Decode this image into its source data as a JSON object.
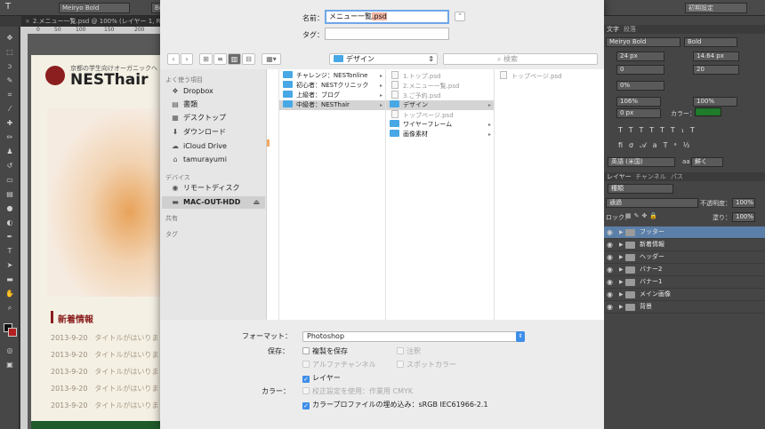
{
  "ps": {
    "tool_icon": "T",
    "font_name": "Meiryo Bold",
    "font_style_short": "Bo",
    "tab_title": "2.メニュー一覧.psd @ 100% (レイヤー 1, RGB",
    "ruler_marks": [
      "0",
      "50",
      "100",
      "150",
      "200"
    ],
    "preset": "初期設定"
  },
  "canvas": {
    "tagline": "京都の学生向けオーガニックヘ",
    "brand": "NESThair",
    "news_title": "新着情報",
    "news": [
      {
        "date": "2013-9-20",
        "title": "タイトルがはいりま"
      },
      {
        "date": "2013-9-20",
        "title": "タイトルがはいりま"
      },
      {
        "date": "2013-9-20",
        "title": "タイトルがはいりま"
      },
      {
        "date": "2013-9-20",
        "title": "タイトルがはいりま"
      },
      {
        "date": "2013-9-20",
        "title": "タイトルがはいりま"
      }
    ]
  },
  "dialog": {
    "name_label": "名前：",
    "name_value_base": "メニュー一覧",
    "name_value_ext": ".psd",
    "tags_label": "タグ：",
    "tags_value": "",
    "location": "デザイン",
    "search_placeholder": "検索",
    "sidebar": {
      "favorites_head": "よく使う項目",
      "favorites": [
        {
          "icon": "dropbox-icon",
          "label": "Dropbox"
        },
        {
          "icon": "documents-icon",
          "label": "書類"
        },
        {
          "icon": "desktop-icon",
          "label": "デスクトップ"
        },
        {
          "icon": "downloads-icon",
          "label": "ダウンロード"
        },
        {
          "icon": "icloud-icon",
          "label": "iCloud Drive"
        },
        {
          "icon": "home-icon",
          "label": "tamurayumi"
        }
      ],
      "devices_head": "デバイス",
      "devices": [
        {
          "icon": "remote-disc-icon",
          "label": "リモートディスク"
        },
        {
          "icon": "hdd-icon",
          "label": "MAC-OUT-HDD"
        }
      ],
      "shared_head": "共有",
      "tags_head": "タグ"
    },
    "columns": {
      "col1": [
        {
          "label": "チャレンジ：NESTonline"
        },
        {
          "label": "初心者：NESTクリニック"
        },
        {
          "label": "上級者：ブログ"
        },
        {
          "label": "中級者：NESThair"
        }
      ],
      "col2": [
        {
          "label": "1.トップ.psd"
        },
        {
          "label": "2.メニュー一覧.psd"
        },
        {
          "label": "3.ご予約.psd"
        },
        {
          "label": "デザイン"
        },
        {
          "label": "トップページ.psd"
        },
        {
          "label": "ワイヤーフレーム"
        },
        {
          "label": "画像素材"
        }
      ],
      "col3": [
        {
          "label": "トップページ.psd"
        }
      ]
    },
    "format_label": "フォーマット：",
    "format_value": "Photoshop",
    "save_label": "保存：",
    "opt_save_copy": "複製を保存",
    "opt_notes": "注釈",
    "opt_alpha": "アルファチャンネル",
    "opt_spot": "スポットカラー",
    "opt_layers": "レイヤー",
    "color_label": "カラー：",
    "opt_proof": "校正設定を使用：作業用 CMYK",
    "opt_icc": "カラープロファイルの埋め込み：sRGB IEC61966-2.1"
  },
  "right_panel": {
    "tab_char": "文字",
    "tab_para": "段落",
    "font_name": "Meiryo Bold",
    "font_style": "Bold",
    "size": "24 px",
    "leading": "14.64 px",
    "tracking_a": "0",
    "tracking_b": "20",
    "scale_pct": "0%",
    "vscale": "106%",
    "hscale": "100%",
    "baseline": "0 px",
    "color_label": "カラー：",
    "lang": "英語 (米国)",
    "aa": "aa",
    "aa_mode": "鮮く",
    "tab_layers": "レイヤー",
    "tab_channels": "チャンネル",
    "tab_paths": "パス",
    "kind": "種類",
    "blend": "通過",
    "opacity_label": "不透明度：",
    "opacity": "100%",
    "lock_label": "ロック：",
    "fill_label": "塗り：",
    "fill": "100%",
    "layers": [
      {
        "name": "フッター",
        "selected": true
      },
      {
        "name": "新着情報",
        "selected": false
      },
      {
        "name": "ヘッダー",
        "selected": false
      },
      {
        "name": "バナー2",
        "selected": false
      },
      {
        "name": "バナー1",
        "selected": false
      },
      {
        "name": "メイン画像",
        "selected": false
      },
      {
        "name": "背景",
        "selected": false
      }
    ]
  },
  "colors": {
    "accent": "#3d8ee8",
    "brand_red": "#8b1e1e",
    "layer_selected": "#5b7fa8",
    "swatch": "#1f7a2a"
  }
}
